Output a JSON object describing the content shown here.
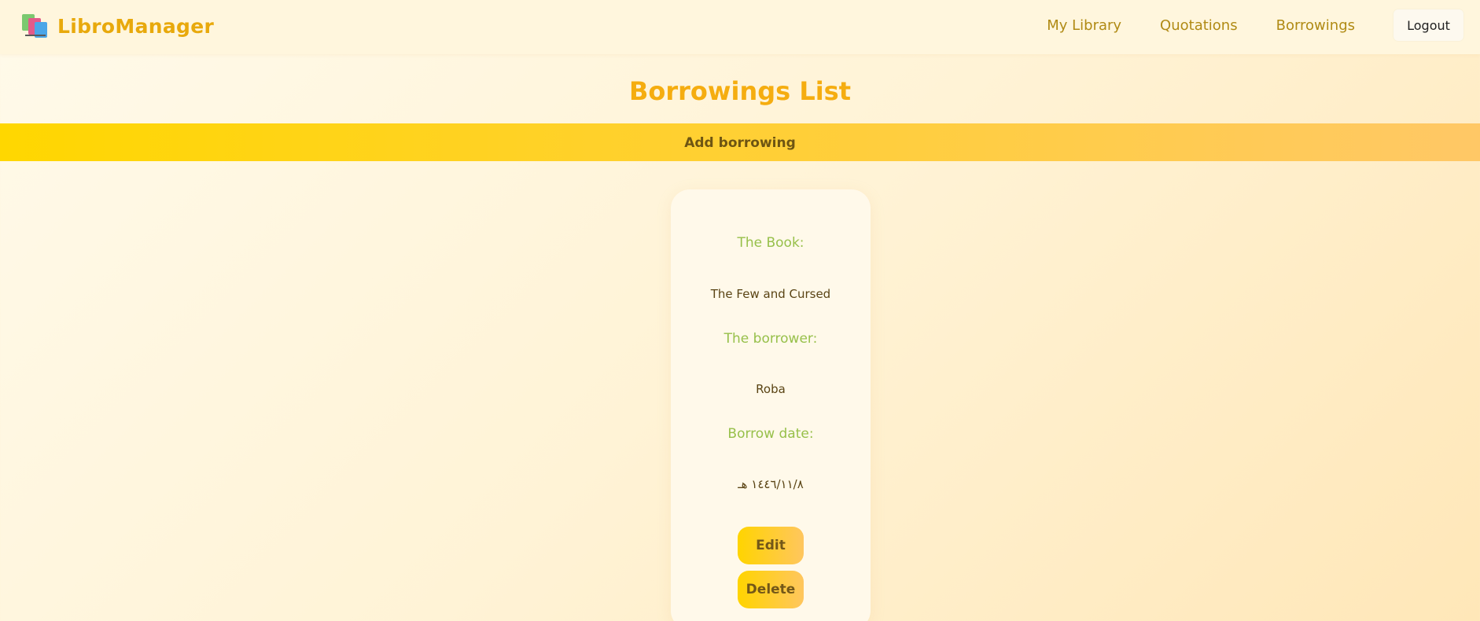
{
  "navbar": {
    "brand": "LibroManager",
    "links": [
      "My Library",
      "Quotations",
      "Borrowings"
    ],
    "logout_label": "Logout"
  },
  "page": {
    "title": "Borrowings List",
    "add_label": "Add borrowing"
  },
  "borrowing": {
    "book_label": "The Book:",
    "book_value": "The Few and Cursed",
    "borrower_label": "The borrower:",
    "borrower_value": "Roba",
    "date_label": "Borrow date:",
    "date_value": "١٤٤٦/١١/٨ هـ",
    "edit_label": "Edit",
    "delete_label": "Delete"
  },
  "colors": {
    "accent": "#f5ad10",
    "label_green": "#97c04a",
    "button_yellow": "#ffd400"
  }
}
